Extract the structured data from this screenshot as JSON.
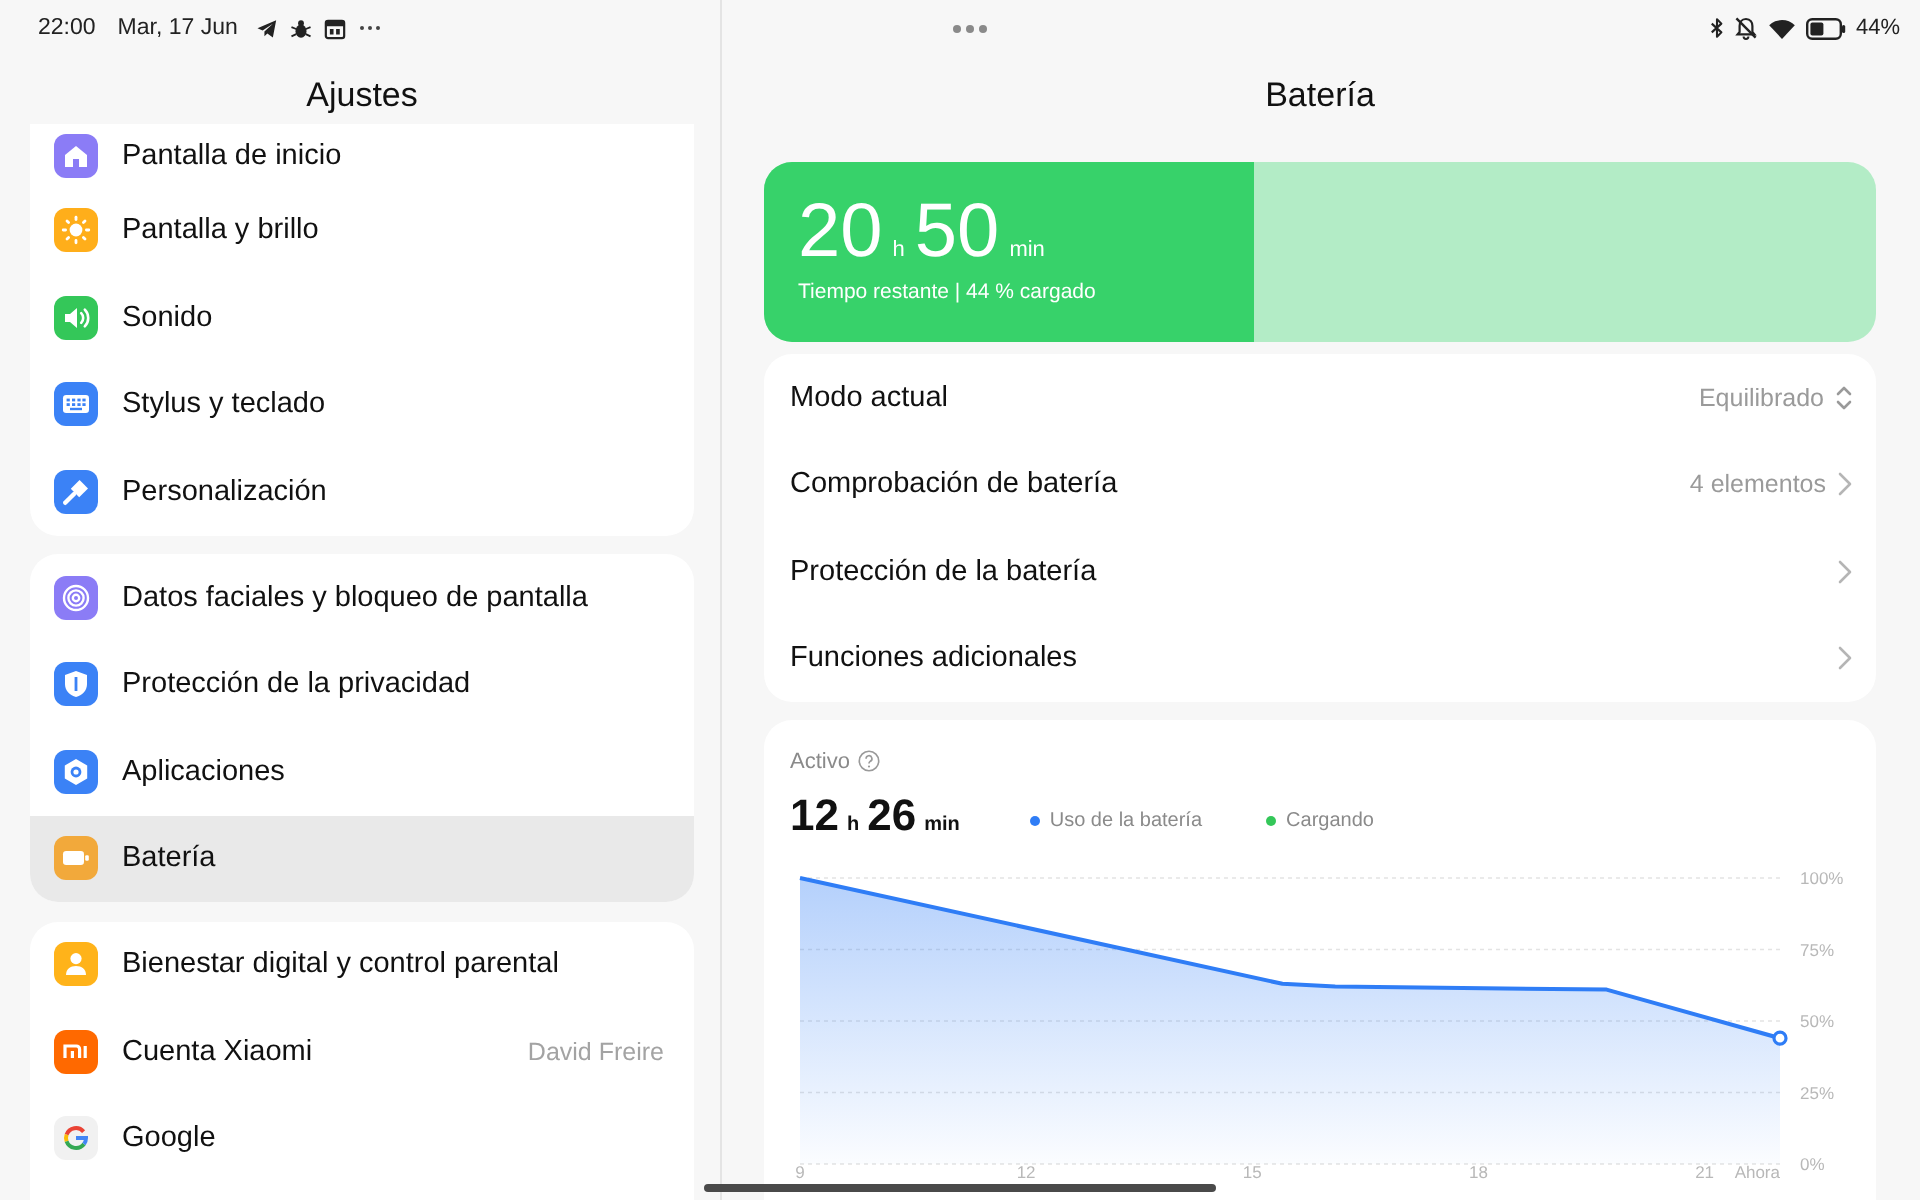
{
  "status_bar": {
    "time": "22:00",
    "date": "Mar, 17 Jun",
    "battery_text": "44%"
  },
  "sidebar": {
    "title": "Ajustes",
    "groups": [
      {
        "items": [
          {
            "label": "Pantalla de inicio",
            "selected": false
          },
          {
            "label": "Pantalla y brillo",
            "selected": false
          },
          {
            "label": "Sonido",
            "selected": false
          },
          {
            "label": "Stylus y teclado",
            "selected": false
          },
          {
            "label": "Personalización",
            "selected": false
          }
        ]
      },
      {
        "items": [
          {
            "label": "Datos faciales y bloqueo de pantalla",
            "selected": false
          },
          {
            "label": "Protección de la privacidad",
            "selected": false
          },
          {
            "label": "Aplicaciones",
            "selected": false
          },
          {
            "label": "Batería",
            "selected": true
          }
        ]
      },
      {
        "items": [
          {
            "label": "Bienestar digital y control parental",
            "selected": false
          },
          {
            "label": "Cuenta Xiaomi",
            "value": "David Freire",
            "selected": false
          },
          {
            "label": "Google",
            "selected": false
          }
        ]
      }
    ]
  },
  "main": {
    "title": "Batería",
    "battery": {
      "hours": "20",
      "hours_unit": "h",
      "minutes": "50",
      "minutes_unit": "min",
      "caption": "Tiempo restante | 44 % cargado",
      "level": 0.44
    },
    "settings": [
      {
        "kind": "select",
        "label": "Modo actual",
        "value": "Equilibrado"
      },
      {
        "kind": "link",
        "label": "Comprobación de batería",
        "value": "4 elementos"
      },
      {
        "kind": "link",
        "label": "Protección de la batería"
      },
      {
        "kind": "link",
        "label": "Funciones adicionales"
      }
    ],
    "usage": {
      "title": "Activo",
      "hours": "12",
      "hours_unit": "h",
      "minutes": "26",
      "minutes_unit": "min",
      "chart_data": {
        "type": "area",
        "x": [
          9,
          15.4,
          16.1,
          19.7,
          22
        ],
        "series": [
          {
            "name": "Uso de la batería",
            "color": "#2f7df6",
            "values": [
              100,
              63,
              62,
              61,
              44
            ]
          },
          {
            "name": "Cargando",
            "color": "#34c759",
            "values": [
              null,
              null,
              null,
              null,
              null
            ]
          }
        ],
        "xlim": [
          9,
          22
        ],
        "ylim": [
          0,
          100
        ],
        "xticks": [
          9,
          12,
          15,
          18,
          21,
          {
            "value": 22,
            "label": "Ahora"
          }
        ],
        "yticks": [
          {
            "value": 0,
            "label": "0%"
          },
          {
            "value": 25,
            "label": "25%"
          },
          {
            "value": 50,
            "label": "50%"
          },
          {
            "value": 75,
            "label": "75%"
          },
          {
            "value": 100,
            "label": "100%"
          }
        ],
        "grid": true
      }
    }
  }
}
